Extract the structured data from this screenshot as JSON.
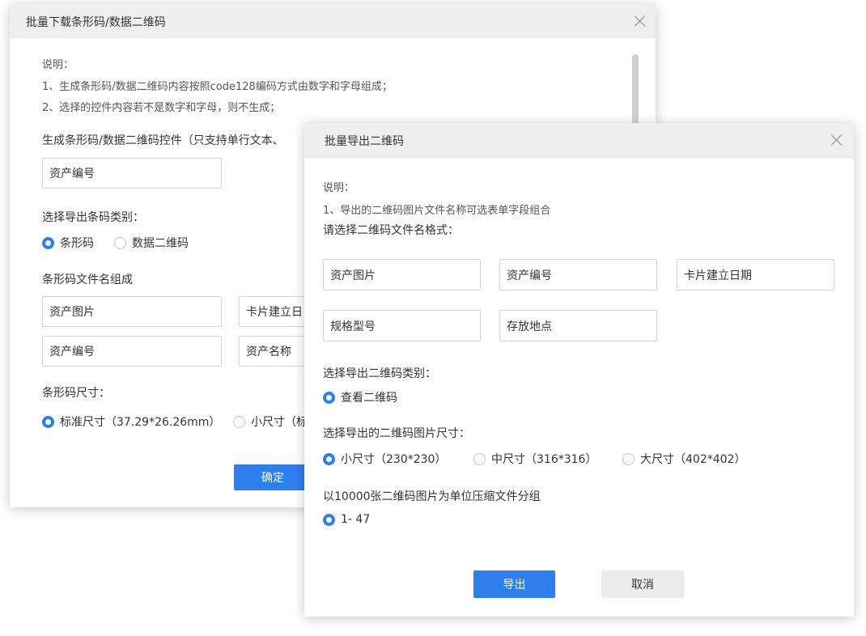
{
  "batch_download": {
    "title": "批量下载条形码/数据二维码",
    "notes": [
      "说明：",
      "1、生成条形码/数据二维码内容按照code128编码方式由数字和字母组成；",
      "2、选择的控件内容若不是数字和字母，则不生成；"
    ],
    "control_label": "生成条形码/数据二维码控件（只支持单行文本、",
    "control_value": "资产编号",
    "type_label": "选择导出条码类别：",
    "type_options": [
      "条形码",
      "数据二维码"
    ],
    "filename_label": "条形码文件名组成",
    "filename_fields": [
      "资产图片",
      "卡片建立日",
      "资产编号",
      "资产名称"
    ],
    "size_label": "条形码尺寸：",
    "size_options": [
      "标准尺寸（37.29*26.26mm）",
      "小尺寸（标"
    ],
    "confirm_label": "确定"
  },
  "batch_export": {
    "title": "批量导出二维码",
    "notes": [
      "说明：",
      "1、导出的二维码图片文件名称可选表单字段组合"
    ],
    "format_label": "请选择二维码文件名格式：",
    "format_fields": [
      "资产图片",
      "资产编号",
      "卡片建立日期",
      "规格型号",
      "存放地点"
    ],
    "type_label": "选择导出二维码类别：",
    "type_option": "查看二维码",
    "size_label": "选择导出的二维码图片尺寸：",
    "size_options": [
      "小尺寸（230*230）",
      "中尺寸（316*316）",
      "大尺寸（402*402）"
    ],
    "group_label": "以10000张二维码图片为单位压缩文件分组",
    "group_option": "1- 47",
    "export_label": "导出",
    "cancel_label": "取消"
  },
  "colors": {
    "accent": "#2d7fee",
    "header_bg": "#efefef"
  }
}
